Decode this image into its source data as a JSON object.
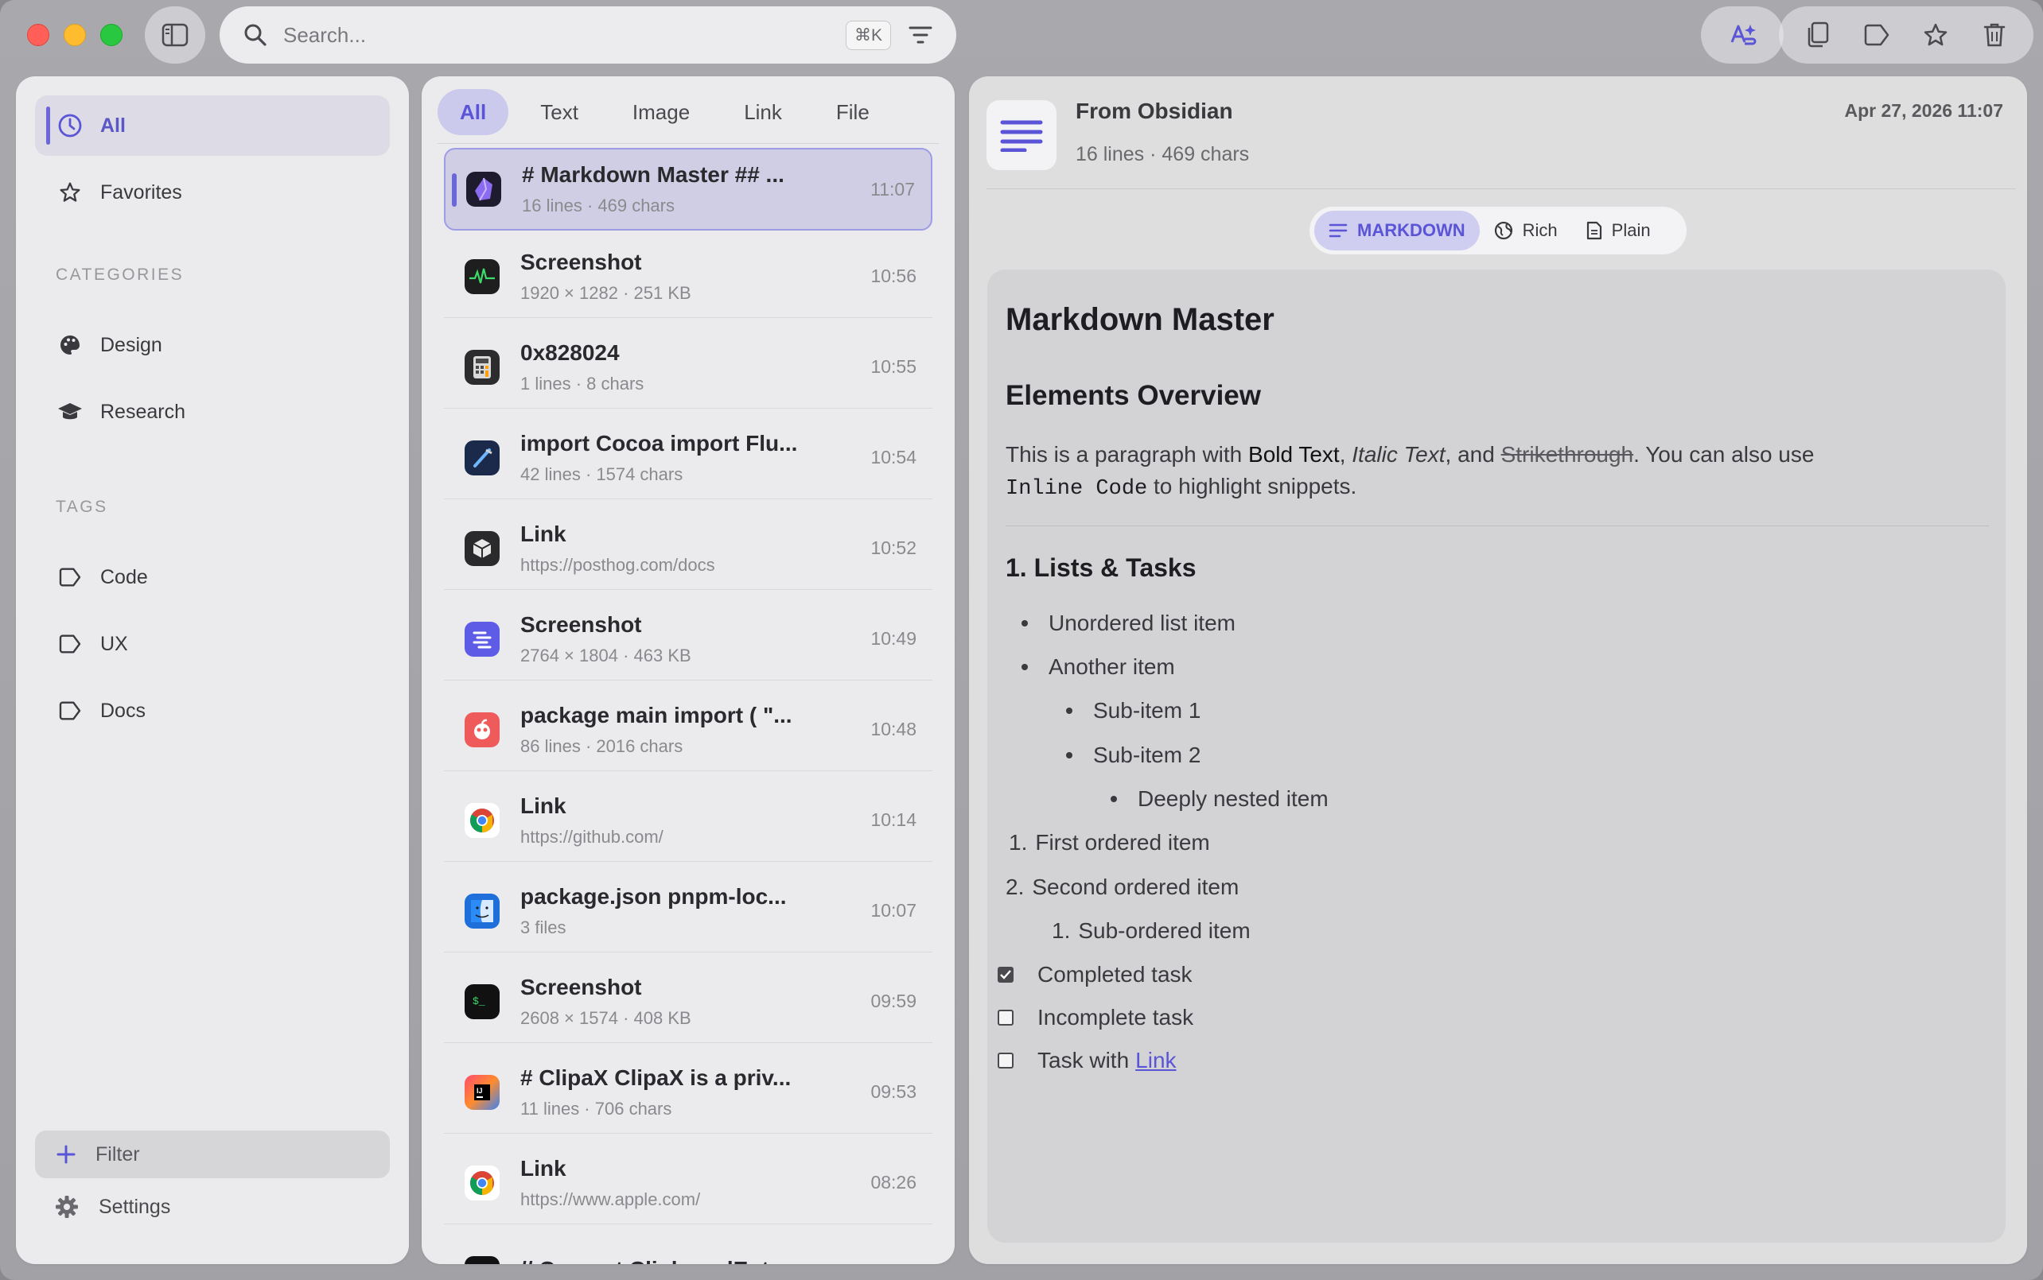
{
  "search": {
    "placeholder": "Search...",
    "shortcut": "⌘K"
  },
  "sidebar": {
    "items": [
      {
        "label": "All"
      },
      {
        "label": "Favorites"
      }
    ],
    "categories_label": "CATEGORIES",
    "categories": [
      {
        "label": "Design"
      },
      {
        "label": "Research"
      }
    ],
    "tags_label": "TAGS",
    "tags": [
      {
        "label": "Code"
      },
      {
        "label": "UX"
      },
      {
        "label": "Docs"
      }
    ],
    "filter_label": "Filter",
    "settings_label": "Settings"
  },
  "list": {
    "tabs": [
      {
        "label": "All"
      },
      {
        "label": "Text"
      },
      {
        "label": "Image"
      },
      {
        "label": "Link"
      },
      {
        "label": "File"
      }
    ],
    "rows": [
      {
        "title": "# Markdown Master ## ...",
        "sub": "16 lines · 469 chars",
        "time": "11:07",
        "icon": "obsidian-icon"
      },
      {
        "title": "Screenshot",
        "sub": "1920 × 1282 · 251 KB",
        "time": "10:56",
        "icon": "activity-monitor-icon"
      },
      {
        "title": "0x828024",
        "sub": "1 lines · 8 chars",
        "time": "10:55",
        "icon": "calculator-icon"
      },
      {
        "title": "import Cocoa import Flu...",
        "sub": "42 lines · 1574 chars",
        "time": "10:54",
        "icon": "xcode-icon"
      },
      {
        "title": "Link",
        "sub": "https://posthog.com/docs",
        "time": "10:52",
        "icon": "cube-app-icon"
      },
      {
        "title": "Screenshot",
        "sub": "2764 × 1804 · 463 KB",
        "time": "10:49",
        "icon": "linear-app-icon"
      },
      {
        "title": "package main import ( \"...",
        "sub": "86 lines · 2016 chars",
        "time": "10:48",
        "icon": "gopher-app-icon"
      },
      {
        "title": "Link",
        "sub": "https://github.com/",
        "time": "10:14",
        "icon": "chrome-icon"
      },
      {
        "title": "package.json pnpm-loc...",
        "sub": "3 files",
        "time": "10:07",
        "icon": "finder-icon"
      },
      {
        "title": "Screenshot",
        "sub": "2608 × 1574 · 408 KB",
        "time": "09:59",
        "icon": "terminal-icon"
      },
      {
        "title": "# ClipaX ClipaX is a priv...",
        "sub": "11 lines · 706 chars",
        "time": "09:53",
        "icon": "intellij-icon"
      },
      {
        "title": "Link",
        "sub": "https://www.apple.com/",
        "time": "08:26",
        "icon": "chrome-icon"
      },
      {
        "title": "// Convert ClipboardEntr...",
        "sub": "",
        "time": "",
        "icon": "terminal-icon"
      }
    ]
  },
  "detail": {
    "source": "From Obsidian",
    "meta": "16 lines · 469 chars",
    "date": "Apr 27, 2026 11:07",
    "modes": [
      {
        "label": "MARKDOWN"
      },
      {
        "label": "Rich"
      },
      {
        "label": "Plain"
      }
    ],
    "content": {
      "h1": "Markdown Master",
      "h2": "Elements Overview",
      "p_intro": "This is a paragraph with ",
      "p_bold": "Bold Text",
      "p_sep1": ", ",
      "p_italic": "Italic Text",
      "p_sep2": ", and ",
      "p_strike": "Strikethrough",
      "p_mid": ". You can also use",
      "p_code": "Inline Code",
      "p_end": " to highlight snippets.",
      "h3": "1. Lists & Tasks",
      "ul": [
        "Unordered list item",
        "Another item"
      ],
      "ul_sub": [
        "Sub-item 1",
        "Sub-item 2"
      ],
      "ul_sub_sub": [
        "Deeply nested item"
      ],
      "ol": [
        "First ordered item",
        "Second ordered item"
      ],
      "ol_nums": [
        "1.",
        "2."
      ],
      "ol_sub": [
        "Sub-ordered item"
      ],
      "ol_sub_num": "1.",
      "tasks": [
        {
          "label": "Completed task",
          "checked": true
        },
        {
          "label": "Incomplete task",
          "checked": false
        },
        {
          "label": "Task with ",
          "checked": false
        }
      ],
      "task_link": "Link"
    }
  },
  "colors": {
    "accent": "#6c67d8",
    "accent_text": "#5a54d6",
    "selected_bg": "#cfcee4"
  }
}
